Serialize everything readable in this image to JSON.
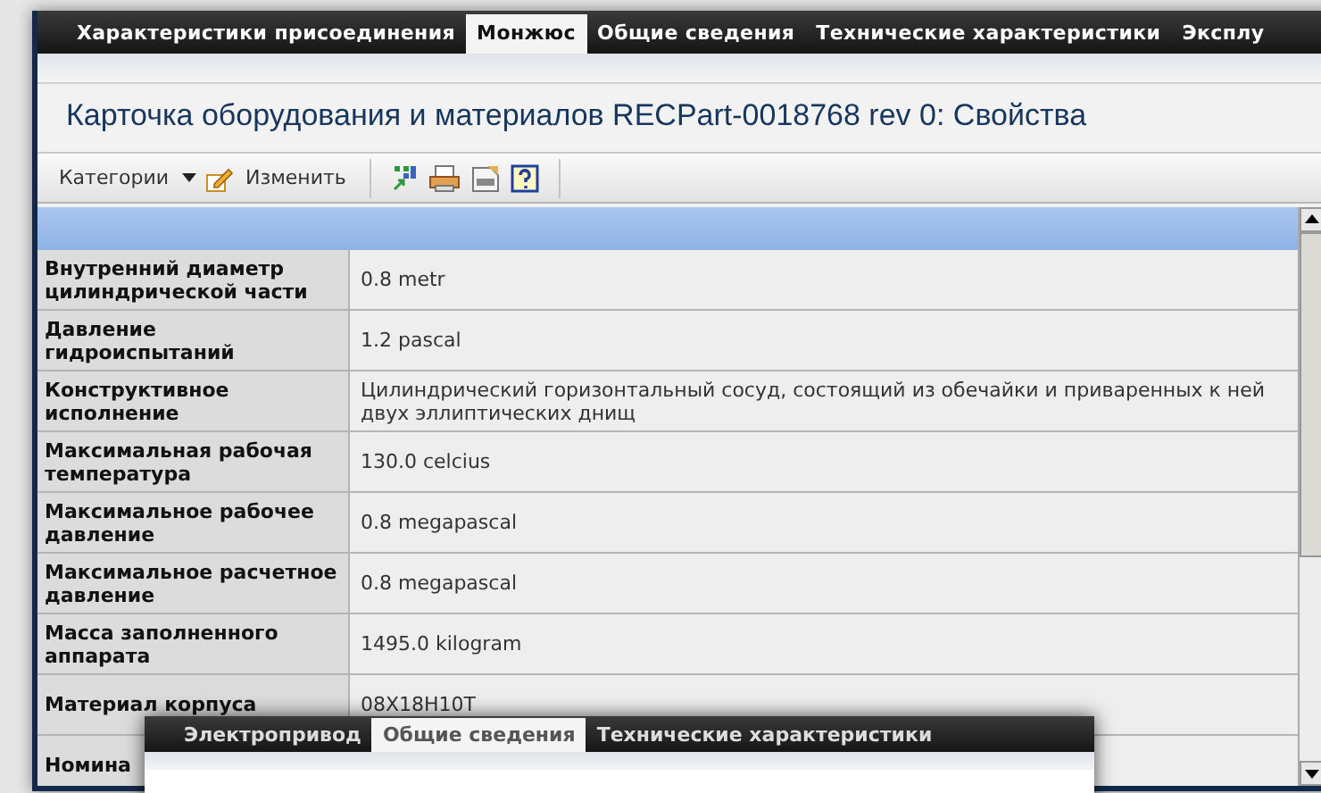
{
  "main_window": {
    "tabs": [
      {
        "label": "Характеристики присоединения",
        "selected": false
      },
      {
        "label": "Монжюс",
        "selected": true
      },
      {
        "label": "Общие сведения",
        "selected": false
      },
      {
        "label": "Технические характеристики",
        "selected": false
      },
      {
        "label": "Эксплу",
        "selected": false
      }
    ],
    "title": "Карточка оборудования и материалов RECPart-0018768 rev 0: Свойства",
    "toolbar": {
      "categories": "Категории",
      "edit": "Изменить"
    },
    "properties": [
      {
        "label": "Внутренний диаметр цилиндрической части",
        "value": "0.8 metr"
      },
      {
        "label": "Давление гидроиспытаний",
        "value": "1.2 pascal"
      },
      {
        "label": "Конструктивное исполнение",
        "value": "Цилиндрический горизонтальный сосуд, состоящий из обечайки и приваренных к ней двух эллиптических днищ"
      },
      {
        "label": "Максимальная рабочая температура",
        "value": "130.0 celcius"
      },
      {
        "label": "Максимальное рабочее давление",
        "value": "0.8 megapascal"
      },
      {
        "label": "Максимальное расчетное давление",
        "value": "0.8 megapascal"
      },
      {
        "label": "Масса заполненного аппарата",
        "value": "1495.0 kilogram"
      },
      {
        "label": "Материал корпуса",
        "value": "08X18H10T"
      },
      {
        "label": "Номина"
      }
    ]
  },
  "overlay_window": {
    "tabs": [
      {
        "label": "Электропривод",
        "selected": false
      },
      {
        "label": "Общие сведения",
        "selected": true
      },
      {
        "label": "Технические характеристики",
        "selected": false
      }
    ]
  }
}
